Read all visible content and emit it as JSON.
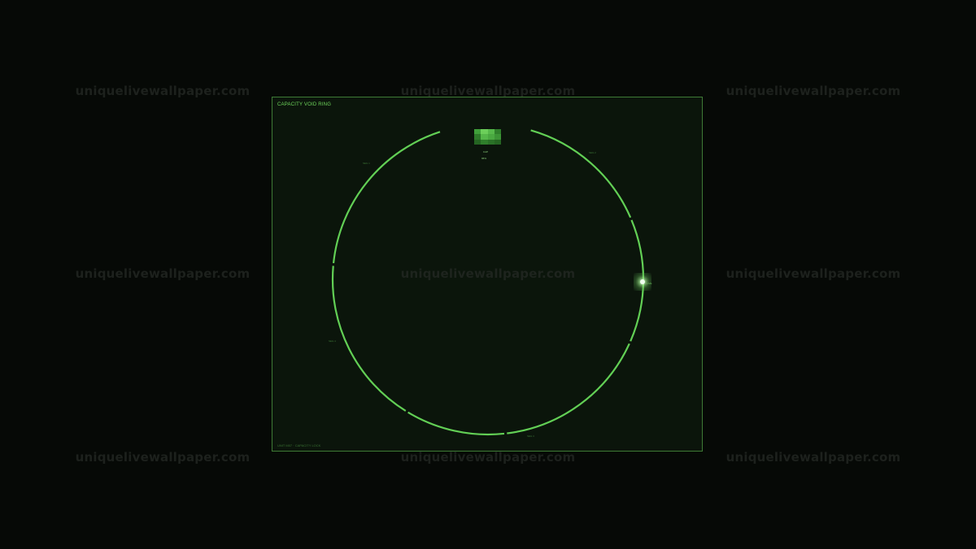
{
  "watermark": {
    "text": "uniquelivewallpaper.com"
  },
  "panel": {
    "title": "CAPACITY VOID RING",
    "footer": "UNIT M07 · CAPACITY LOCK"
  },
  "hub": {
    "line1": "CAP",
    "line2": "96%",
    "cells": [
      "#3fa03a",
      "#6ccf5a",
      "#55b84a",
      "#2f7f2b",
      "#2e7a2a",
      "#55b84a",
      "#4aa941",
      "#3c9436",
      "#256522",
      "#2f7f2b",
      "#2a7127",
      "#256522"
    ]
  },
  "ring_labels": {
    "upper_left": "SEG 1",
    "upper_right": "SEG 2",
    "lower_left": "SEG 4",
    "bottom": "SEG 3"
  },
  "marker": {
    "label": "LIVE"
  },
  "colors": {
    "ring": "#62cf55",
    "accent": "#6fd75c",
    "panel_bg": "#0b150b",
    "border": "#3e7a35"
  }
}
